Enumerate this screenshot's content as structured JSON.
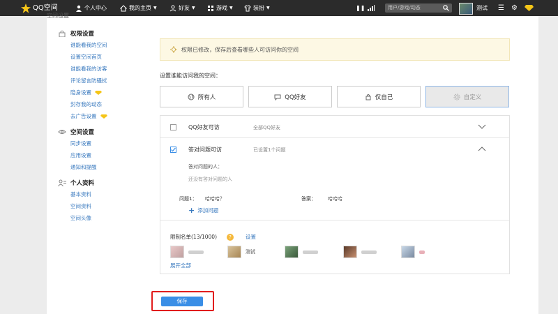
{
  "topbar": {
    "logo": "QQ空间",
    "personal_center": "个人中心",
    "my_homepage": "我的主页",
    "friends": "好友",
    "games": "游戏",
    "dress_up": "装扮",
    "search_placeholder": "用户/游戏/动态",
    "username": "测试",
    "colors": {
      "bar": "#2b2b2b",
      "logo_star": "#f5c518"
    }
  },
  "page": {
    "title": "空间设置"
  },
  "sidebar": {
    "groups": [
      {
        "title": "权限设置",
        "icon": "lock-icon",
        "items": [
          {
            "label": "谁能看我的空间"
          },
          {
            "label": "设置空间首页"
          },
          {
            "label": "谁能看我的访客"
          },
          {
            "label": "评论留言防骚扰"
          },
          {
            "label": "隐身设置",
            "badge": "diamond-icon"
          },
          {
            "label": "封存我的动态"
          },
          {
            "label": "去广告设置",
            "badge": "diamond-icon"
          }
        ]
      },
      {
        "title": "空间设置",
        "icon": "space-icon",
        "items": [
          {
            "label": "同步设置"
          },
          {
            "label": "应用设置"
          },
          {
            "label": "通知和提醒"
          }
        ]
      },
      {
        "title": "个人资料",
        "icon": "person-icon",
        "items": [
          {
            "label": "基本资料"
          },
          {
            "label": "空间资料"
          },
          {
            "label": "空间头像"
          }
        ]
      }
    ]
  },
  "notice": {
    "text": "权限已修改，保存后查看哪些人可访问你的空间",
    "icon": "lightbulb-icon"
  },
  "who_can_access": {
    "label": "设置谁能访问我的空间：",
    "options": [
      {
        "label": "所有人",
        "icon": "globe-icon"
      },
      {
        "label": "QQ好友",
        "icon": "chat-icon"
      },
      {
        "label": "仅自己",
        "icon": "lock-icon"
      },
      {
        "label": "自定义",
        "icon": "gear-icon",
        "selected": true
      }
    ]
  },
  "custom": {
    "qq_friends": {
      "title": "QQ好友可访",
      "subtitle": "全部QQ好友",
      "checked": false
    },
    "answer_question": {
      "title": "答对问题可访",
      "subtitle": "已设置1个问题",
      "checked": true,
      "answered_label": "答对问题的人：",
      "answered_empty": "还没有答对问题的人",
      "question_label": "问题1：",
      "question_value": "哈哈哈？",
      "answer_label": "答案：",
      "answer_value": "哈哈哈",
      "add_question": "添加问题"
    },
    "restricted": {
      "label": "限制名单(13/1000)",
      "settings_link": "设置",
      "members": [
        {
          "name": ""
        },
        {
          "name": "测试"
        },
        {
          "name": ""
        },
        {
          "name": ""
        },
        {
          "name": ""
        }
      ],
      "expand_all": "展开全部"
    }
  },
  "save_button": "保存"
}
